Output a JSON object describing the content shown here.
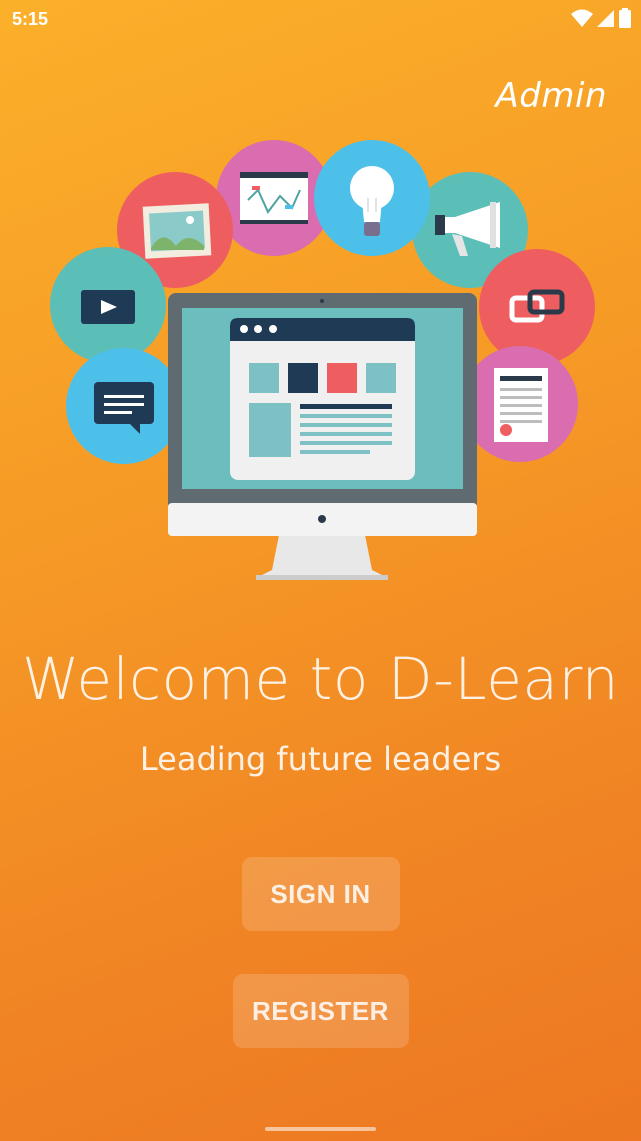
{
  "status_bar": {
    "time": "5:15",
    "icons": [
      "wifi-icon",
      "signal-icon",
      "battery-icon"
    ]
  },
  "header": {
    "admin_label": "Admin"
  },
  "hero": {
    "icons": [
      "video-icon",
      "chat-icon",
      "picture-icon",
      "chart-board-icon",
      "lightbulb-icon",
      "megaphone-icon",
      "link-icon",
      "certificate-icon",
      "monitor-icon"
    ]
  },
  "main": {
    "title": "Welcome to D-Learn",
    "tagline": "Leading future leaders"
  },
  "actions": {
    "sign_in_label": "SIGN IN",
    "register_label": "REGISTER"
  },
  "colors": {
    "background_top": "#FBB02A",
    "background_bottom": "#ED7722",
    "teal": "#5BBFB8",
    "pink": "#D96DAF",
    "blue": "#4DC0EA",
    "coral": "#EE5E60",
    "navy": "#1F3A55"
  }
}
